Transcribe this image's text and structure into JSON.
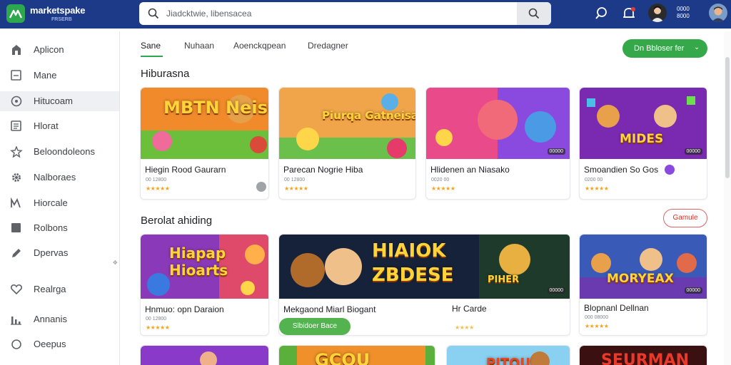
{
  "app": {
    "name": "marketspake",
    "subtitle": "FRSERB",
    "brand_color": "#1c3a87",
    "accent_color": "#2ea84f"
  },
  "search": {
    "value": "Jiadcktwie, libensacea",
    "search_icon": "search-icon",
    "button_icon": "search-icon"
  },
  "header": {
    "icons": [
      "search-icon",
      "bell-icon",
      "avatar",
      "avatar"
    ],
    "account_line1": "0000",
    "account_line2": "8000"
  },
  "sidebar": {
    "items": [
      {
        "label": "Aplicon",
        "icon": "home-icon"
      },
      {
        "label": "Mane",
        "icon": "square-icon"
      },
      {
        "label": "Hitucoam",
        "icon": "compass-icon"
      },
      {
        "label": "Hlorat",
        "icon": "list-icon"
      },
      {
        "label": "Beloondoleons",
        "icon": "star-icon"
      },
      {
        "label": "Nalboraes",
        "icon": "gear-icon"
      },
      {
        "label": "Hiorcale",
        "icon": "chart-icon"
      },
      {
        "label": "Rolbons",
        "icon": "box-icon"
      },
      {
        "label": "Dpervas",
        "icon": "edit-icon"
      },
      {
        "label": "Realrga",
        "icon": "heart-icon"
      },
      {
        "label": "Annanis",
        "icon": "bar-icon"
      },
      {
        "label": "Oeepus",
        "icon": "circle-icon"
      }
    ],
    "active_index": 2
  },
  "tabs": [
    {
      "label": "Sane"
    },
    {
      "label": "Nuhaan"
    },
    {
      "label": "Aoenckqpean"
    },
    {
      "label": "Dredagner"
    }
  ],
  "cta": {
    "label": "Dn Bbloser fer",
    "icon": "chevron-down-icon"
  },
  "sections": [
    {
      "title": "Hiburasna",
      "cards": [
        {
          "art": "MBTN Neisarplelen",
          "title": "Hiegin Rood Gaurarn",
          "meta": "00 12800",
          "stars": "★★★★★"
        },
        {
          "art": "Piurqa Gatneisa",
          "title": "Parecan Nogrie Hiba",
          "meta": "00 12800",
          "stars": "★★★★★"
        },
        {
          "art": "",
          "title": "Hlidenen an Niasako",
          "meta": "0020 00",
          "stars": "★★★★★",
          "pill": "00000"
        },
        {
          "art": "MIDES",
          "title": "Smoandien So Gos",
          "meta": "0200 00",
          "stars": "★★★★★",
          "pill": "00000"
        }
      ]
    },
    {
      "title": "Berolat ahiding",
      "button": "Gamule",
      "cards": [
        {
          "art": "Hiapap Hioarts",
          "title": "Hnmuo: opn Daraion",
          "meta": "00 12800",
          "stars": "★★★★★"
        },
        {
          "art": "HIAIOK ZBDESE",
          "title": "Mekgaond Miarl Biogant",
          "title2": "Hr Carde",
          "meta": "",
          "stars": "★★★★",
          "pill": "00000",
          "art_badge": "PIHER",
          "button": "Slbidoer Bace"
        },
        {
          "art": "MORYEAX",
          "title": "Blopnanl Dellnan",
          "meta": "000 08000",
          "stars": "★★★★★",
          "pill": "00000"
        }
      ]
    },
    {
      "cards": [
        {
          "art": ""
        },
        {
          "art": "GCOU"
        },
        {
          "art": "PITOU"
        },
        {
          "art": "SEURMAN"
        }
      ]
    }
  ]
}
